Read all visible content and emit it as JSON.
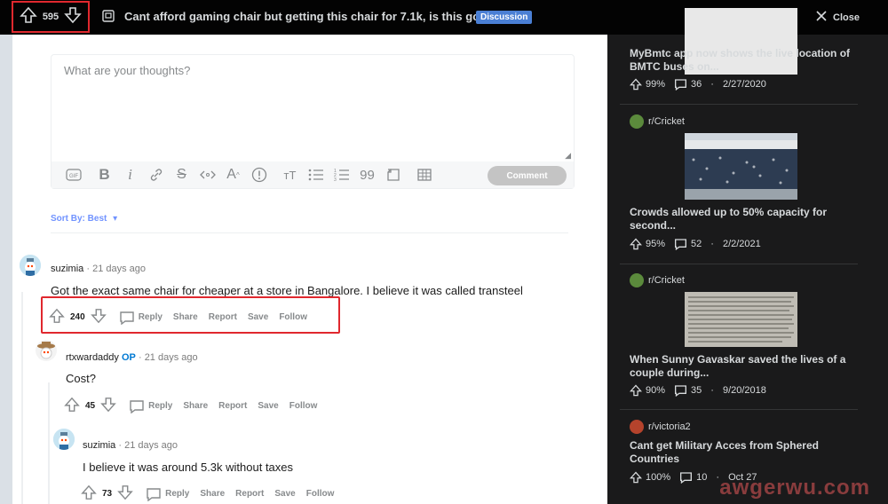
{
  "header": {
    "vote_count": "595",
    "title": "Cant afford gaming chair but getting this chair for 7.1k, is this good?",
    "flair": "Discussion",
    "close_label": "Close"
  },
  "editor": {
    "placeholder": "What are your thoughts?",
    "comment_button": "Comment",
    "toolbar_icons": [
      "gif-icon",
      "bold-icon",
      "italic-icon",
      "link-icon",
      "strikethrough-icon",
      "inline-code-icon",
      "superscript-icon",
      "spoiler-icon",
      "heading-icon",
      "bullet-list-icon",
      "numbered-list-icon",
      "quote-icon",
      "code-block-icon",
      "table-icon"
    ]
  },
  "sort": {
    "label": "Sort By: Best"
  },
  "comments": [
    {
      "author": "suzimia",
      "time": "21 days ago",
      "op": "",
      "text": "Got the exact same chair for cheaper at a store in Bangalore. I believe it was called transteel",
      "votes": "240",
      "reply": "Reply",
      "share": "Share",
      "report": "Report",
      "save": "Save",
      "follow": "Follow"
    },
    {
      "author": "rtxwardaddy",
      "time": "21 days ago",
      "op": "OP",
      "text": "Cost?",
      "votes": "45",
      "reply": "Reply",
      "share": "Share",
      "report": "Report",
      "save": "Save",
      "follow": "Follow"
    },
    {
      "author": "suzimia",
      "time": "21 days ago",
      "op": "",
      "text": "I believe it was around 5.3k without taxes",
      "votes": "73",
      "reply": "Reply",
      "share": "Share",
      "report": "Report",
      "save": "Save",
      "follow": "Follow"
    }
  ],
  "sidebar": {
    "posts": [
      {
        "subreddit": "",
        "title": "MyBmtc app now shows the live location of BMTC buses on...",
        "upvote_pct": "99%",
        "comments": "36",
        "date": "2/27/2020"
      },
      {
        "subreddit": "r/Cricket",
        "title": "Crowds allowed up to 50% capacity for second...",
        "upvote_pct": "95%",
        "comments": "52",
        "date": "2/2/2021"
      },
      {
        "subreddit": "r/Cricket",
        "title": "When Sunny Gavaskar saved the lives of a couple during...",
        "upvote_pct": "90%",
        "comments": "35",
        "date": "9/20/2018"
      },
      {
        "subreddit": "r/victoria2",
        "title": "Cant get Military Acces from Sphered Countries",
        "upvote_pct": "100%",
        "comments": "10",
        "date": "Oct 27"
      }
    ],
    "separator": "·"
  },
  "watermark": "awgerwu.com",
  "colors": {
    "highlight": "#e0282e",
    "flair_bg": "#4a7fd4",
    "op": "#0079d3",
    "sort": "#7193ff"
  }
}
